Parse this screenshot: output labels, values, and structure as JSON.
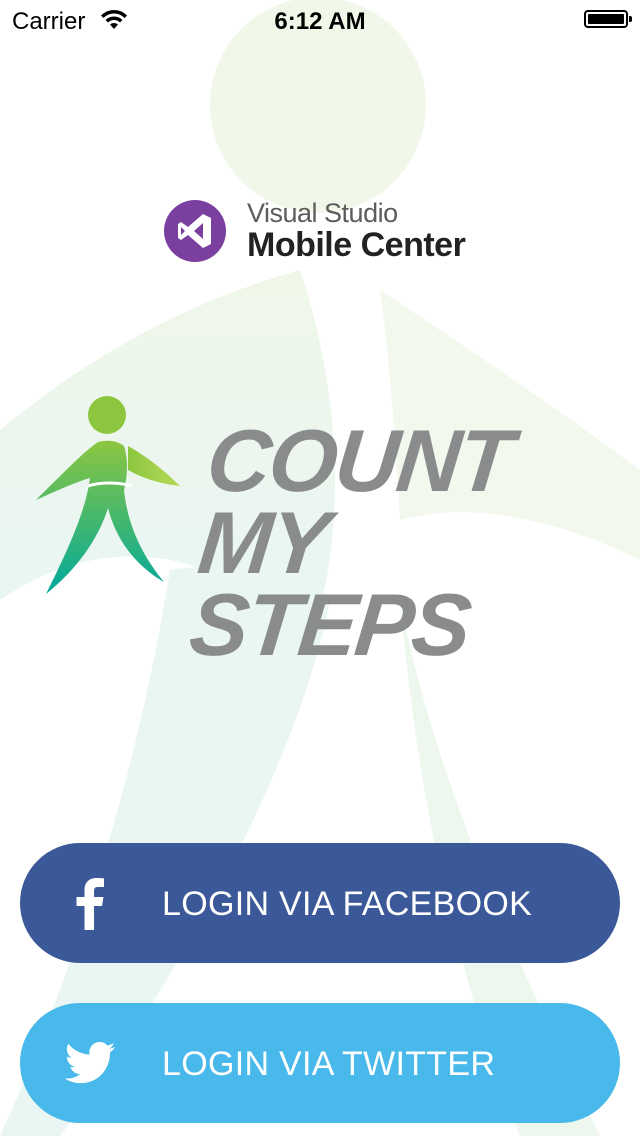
{
  "status_bar": {
    "carrier": "Carrier",
    "time": "6:12 AM",
    "wifi_icon": "wifi-icon",
    "battery_icon": "battery-full-icon"
  },
  "branding": {
    "vs_line1": "Visual Studio",
    "vs_line2": "Mobile Center",
    "vs_icon": "visual-studio-logo-icon",
    "vs_color": "#7b3fa0"
  },
  "app": {
    "title_line1": "COUNT MY",
    "title_line2": "STEPS",
    "logo_icon": "walking-person-icon",
    "title_color": "#8a8b8d",
    "logo_green": "#8cc63f",
    "logo_teal": "#00a99d"
  },
  "login": {
    "facebook_label": "LOGIN VIA FACEBOOK",
    "facebook_icon": "facebook-icon",
    "facebook_color": "#3b5998",
    "twitter_label": "LOGIN VIA TWITTER",
    "twitter_icon": "twitter-icon",
    "twitter_color": "#48b9ea"
  }
}
